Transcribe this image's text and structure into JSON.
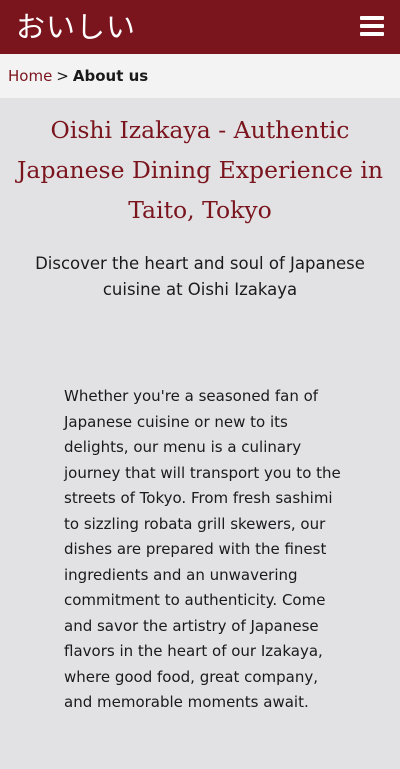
{
  "header": {
    "logo_text": "おいしい",
    "menu_icon": "hamburger-menu-icon",
    "bg_color": "#7a141d"
  },
  "breadcrumb": {
    "home_label": "Home",
    "separator": ">",
    "current_label": "About us"
  },
  "main": {
    "title": "Oishi Izakaya - Authentic Japanese Dining Experience in Taito, Tokyo",
    "subtitle": "Discover the heart and soul of Japanese cuisine at Oishi Izakaya",
    "body": "Whether you're a seasoned fan of Japanese cuisine or new to its delights, our menu is a culinary journey that will transport you to the streets of Tokyo. From fresh sashimi to sizzling robata grill skewers, our dishes are prepared with the finest ingredients and an unwavering commitment to authenticity. Come and savor the artistry of Japanese flavors in the heart of our Izakaya, where good food, great company, and memorable moments await."
  },
  "colors": {
    "accent": "#7a141d",
    "page_bg": "#e2e2e4",
    "breadcrumb_bg": "#f3f3f3"
  }
}
